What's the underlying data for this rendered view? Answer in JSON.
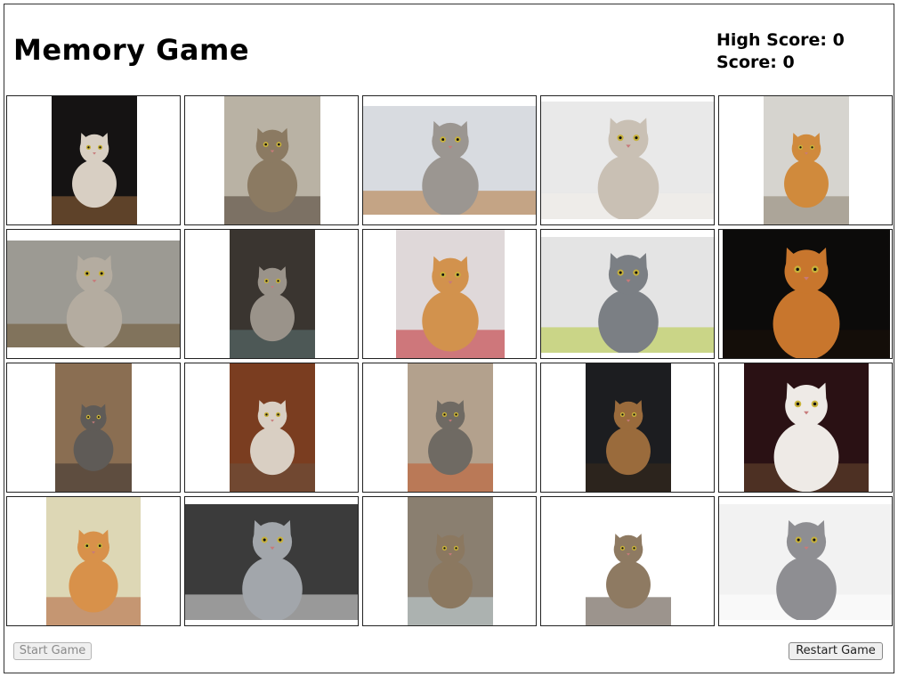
{
  "header": {
    "title": "Memory Game",
    "high_score_label": "High Score:",
    "high_score": "0",
    "score_label": "Score:",
    "score": "0"
  },
  "cards": [
    {
      "subject": "calico-cat-sitting",
      "bg": "#151313",
      "fur": "#d8cfc3",
      "accent": "#9a6a3c"
    },
    {
      "subject": "tabby-kitten-sitting",
      "bg": "#b9b2a4",
      "fur": "#8b7a62",
      "accent": "#4a3d2f"
    },
    {
      "subject": "gray-white-cat-in-basket",
      "bg": "#d8dbe0",
      "fur": "#9b9691",
      "accent": "#b4773a"
    },
    {
      "subject": "cat-lying-on-rug",
      "bg": "#e9e9e9",
      "fur": "#c9c0b4",
      "accent": "#f2efea"
    },
    {
      "subject": "orange-cat-at-window",
      "bg": "#d6d4cf",
      "fur": "#d08a3c",
      "accent": "#8a7d6d"
    },
    {
      "subject": "tabby-cat-peeking-over-couch",
      "bg": "#9c9a93",
      "fur": "#b4aca0",
      "accent": "#6b5330"
    },
    {
      "subject": "gray-cat-looking-up",
      "bg": "#3a3530",
      "fur": "#9a938a",
      "accent": "#5d7476"
    },
    {
      "subject": "orange-white-cat-with-bandana",
      "bg": "#dfd8d9",
      "fur": "#d2924d",
      "accent": "#c0282d"
    },
    {
      "subject": "gray-cat-green-eyes",
      "bg": "#e4e4e4",
      "fur": "#7b7f84",
      "accent": "#b4c83a"
    },
    {
      "subject": "tiger-lying-down",
      "bg": "#0c0b0a",
      "fur": "#c8762d",
      "accent": "#1b1209"
    },
    {
      "subject": "gray-tabby-standing-up",
      "bg": "#8a6e52",
      "fur": "#5f5b57",
      "accent": "#3a3330"
    },
    {
      "subject": "tabby-kitten-on-floor",
      "bg": "#7a3d20",
      "fur": "#d9cfc3",
      "accent": "#6a5240"
    },
    {
      "subject": "kitten-in-basket",
      "bg": "#b3a18d",
      "fur": "#6f6a63",
      "accent": "#c05a2b"
    },
    {
      "subject": "tabby-cat-looking-up-dark",
      "bg": "#1c1d20",
      "fur": "#9a6b3c",
      "accent": "#3a2a1b"
    },
    {
      "subject": "white-kitten-blue-eyes",
      "bg": "#2a1114",
      "fur": "#eeeae6",
      "accent": "#6a4a30"
    },
    {
      "subject": "orange-tabby-portrait",
      "bg": "#ddd7b5",
      "fur": "#d8914a",
      "accent": "#b0603a"
    },
    {
      "subject": "gray-cat-licking-paw",
      "bg": "#3b3b3b",
      "fur": "#a2a6ab",
      "accent": "#e8e8e8"
    },
    {
      "subject": "tabby-cat-lying-paws",
      "bg": "#8a7f70",
      "fur": "#8b7860",
      "accent": "#c9dde6"
    },
    {
      "subject": "tabby-cat-sitting-white",
      "bg": "#ffffff",
      "fur": "#8e7a62",
      "accent": "#4a3d2f"
    },
    {
      "subject": "gray-white-cat-close-up",
      "bg": "#f2f2f2",
      "fur": "#8e8e92",
      "accent": "#ffffff"
    }
  ],
  "buttons": {
    "start": "Start Game",
    "restart": "Restart Game"
  }
}
